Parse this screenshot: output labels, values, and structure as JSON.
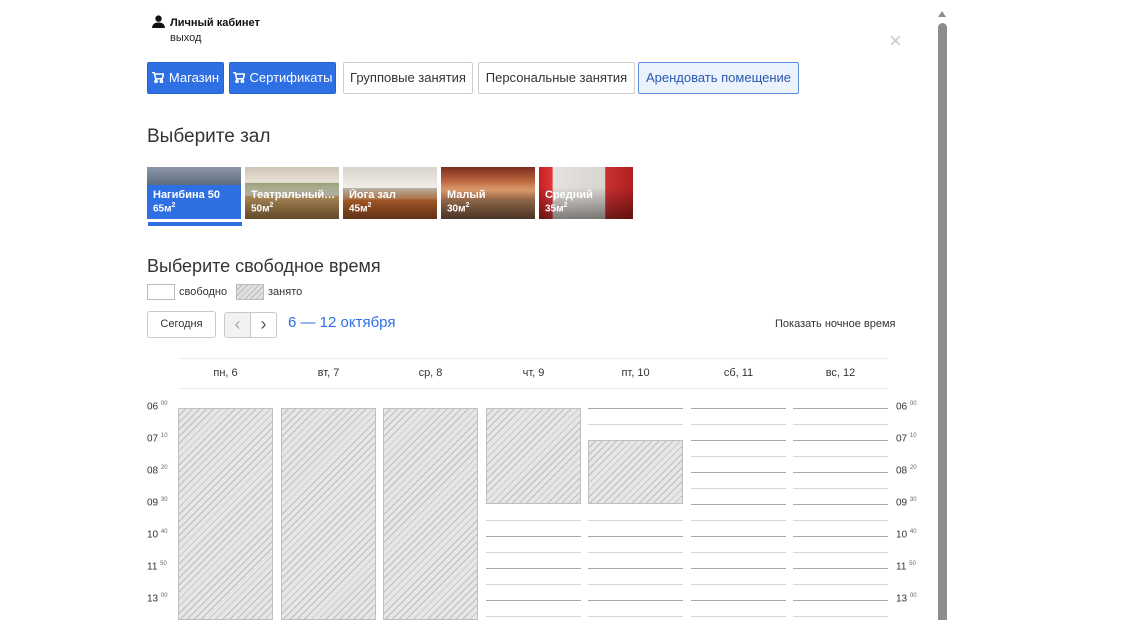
{
  "user": {
    "name": "Личный кабинет",
    "logout": "выход"
  },
  "close": "×",
  "tabs": [
    {
      "label": "Магазин",
      "style": "primary",
      "icon": "cart-icon"
    },
    {
      "label": "Сертификаты",
      "style": "primary",
      "icon": "cart-icon"
    },
    {
      "label": "Групповые занятия",
      "style": "default"
    },
    {
      "label": "Персональные занятия",
      "style": "default"
    },
    {
      "label": "Арендовать помещение",
      "style": "active"
    }
  ],
  "halls_heading": "Выберите зал",
  "halls": [
    {
      "name": "Нагибина 50",
      "area": "65м",
      "selected": true
    },
    {
      "name": "Театральный…",
      "area": "50м",
      "selected": false
    },
    {
      "name": "Йога зал",
      "area": "45м",
      "selected": false
    },
    {
      "name": "Малый",
      "area": "30м",
      "selected": false
    },
    {
      "name": "Средний",
      "area": "35м",
      "selected": false
    }
  ],
  "area_sup": "2",
  "time_heading": "Выберите свободное время",
  "legend": {
    "free": "свободно",
    "busy": "занято"
  },
  "toolbar": {
    "today": "Сегодня",
    "prev": "‹",
    "next": "›",
    "range": "6 — 12 октября",
    "night": "Показать ночное время"
  },
  "days": [
    "пн, 6",
    "вт, 7",
    "ср, 8",
    "чт, 9",
    "пт, 10",
    "сб, 11",
    "вс, 12"
  ],
  "time_rows": [
    {
      "h": "06",
      "m": "00"
    },
    {
      "h": "07",
      "m": "10"
    },
    {
      "h": "08",
      "m": "20"
    },
    {
      "h": "09",
      "m": "30"
    },
    {
      "h": "10",
      "m": "40"
    },
    {
      "h": "11",
      "m": "50"
    },
    {
      "h": "13",
      "m": "00"
    }
  ],
  "busy_until_row": [
    7,
    7,
    7,
    3,
    3,
    0,
    0
  ],
  "busy_from_row": [
    0,
    0,
    0,
    0,
    1,
    0,
    0
  ],
  "colors": {
    "accent": "#2f6fe4",
    "active_tab_bg": "#eaf2fd"
  }
}
